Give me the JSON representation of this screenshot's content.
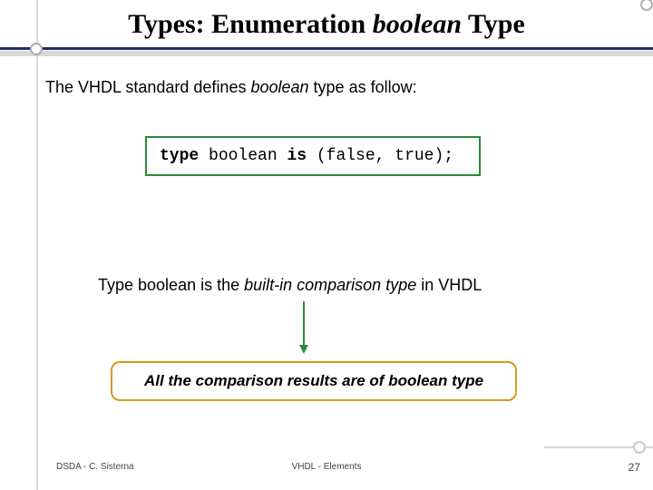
{
  "title": {
    "pre": "Types: Enumeration ",
    "ital": "boolean",
    "post": " Type"
  },
  "intro": {
    "pre": "The VHDL standard defines ",
    "ital": "boolean",
    "post": "  type as follow:"
  },
  "code": {
    "kw1": "type",
    "mid": " boolean ",
    "kw2": "is",
    "tail": " (false, true);"
  },
  "mid": {
    "pre": "Type boolean is the ",
    "ital": "built-in comparison type",
    "post": " in VHDL"
  },
  "callout": "All the comparison results are of boolean type",
  "footer": {
    "left": "DSDA - C. Sisterna",
    "center": "VHDL - Elements",
    "page": "27"
  },
  "colors": {
    "accent_line": "#1a2f6b",
    "code_border": "#2c8a3a",
    "callout_border": "#d99a1a"
  }
}
